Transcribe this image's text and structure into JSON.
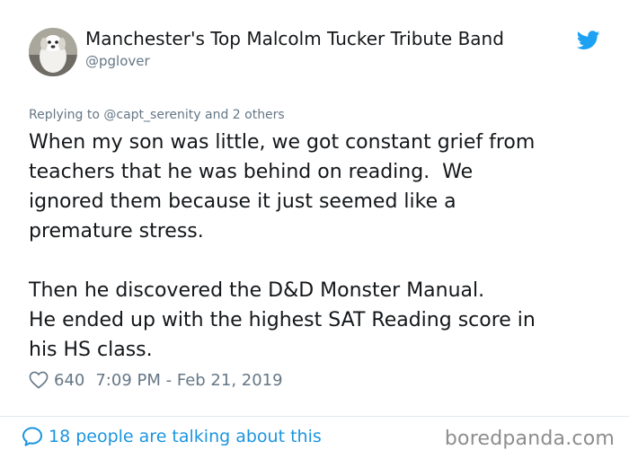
{
  "author": {
    "display_name": "Manchester's Top Malcolm Tucker Tribute Band",
    "handle": "@pglover"
  },
  "tweet": {
    "replying_to": "Replying to @capt_serenity and 2 others",
    "paragraph1": [
      "When my son was little, we got constant grief from",
      "teachers that he was behind on reading.  We",
      "ignored them because it just seemed like a",
      "premature stress."
    ],
    "paragraph2": [
      "Then he discovered the D&D Monster Manual.",
      "He ended up with the highest SAT Reading score in",
      "his HS class."
    ],
    "likes": "640",
    "timestamp": "7:09 PM - Feb 21, 2019"
  },
  "footer": {
    "talking_text": "18 people are talking about this",
    "watermark": "boredpanda.com"
  },
  "colors": {
    "twitter_blue": "#1da1f2",
    "link_blue": "#1b95e0",
    "muted_gray": "#657786"
  },
  "icons": {
    "brand": "twitter-bird-icon",
    "like": "heart-icon",
    "reply": "speech-bubble-icon"
  }
}
